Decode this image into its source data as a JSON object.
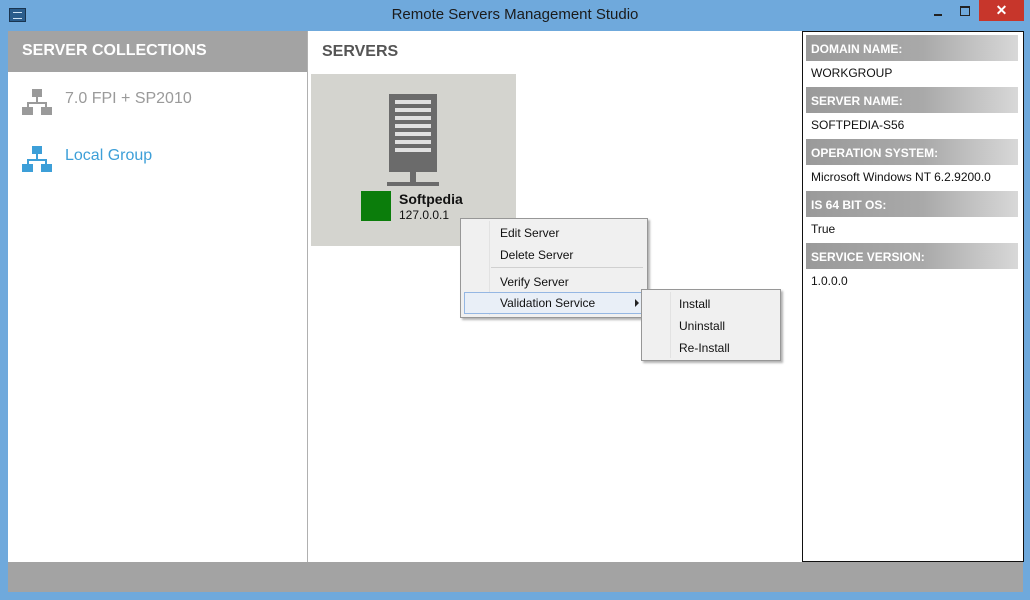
{
  "window": {
    "title": "Remote Servers Management Studio",
    "close_glyph": "✕"
  },
  "left": {
    "header": "SERVER COLLECTIONS",
    "items": [
      {
        "label": "7.0 FPI + SP2010",
        "icon": "network-icon",
        "color": "#9a9a9a"
      },
      {
        "label": "Local Group",
        "icon": "network-icon",
        "color": "#3d9fd8"
      }
    ]
  },
  "middle": {
    "header": "SERVERS",
    "server": {
      "name": "Softpedia",
      "ip": "127.0.0.1",
      "status_color": "#0b7d0b"
    }
  },
  "right": {
    "props": [
      {
        "label": "DOMAIN NAME:",
        "value": "WORKGROUP"
      },
      {
        "label": "SERVER NAME:",
        "value": "SOFTPEDIA-S56"
      },
      {
        "label": "OPERATION SYSTEM:",
        "value": "Microsoft Windows NT 6.2.9200.0"
      },
      {
        "label": "IS 64 BIT OS:",
        "value": "True"
      },
      {
        "label": "SERVICE VERSION:",
        "value": "1.0.0.0"
      }
    ]
  },
  "context_menu": {
    "items": [
      "Edit Server",
      "Delete Server",
      "Verify Server",
      "Validation Service"
    ],
    "submenu": [
      "Install",
      "Uninstall",
      "Re-Install"
    ]
  }
}
